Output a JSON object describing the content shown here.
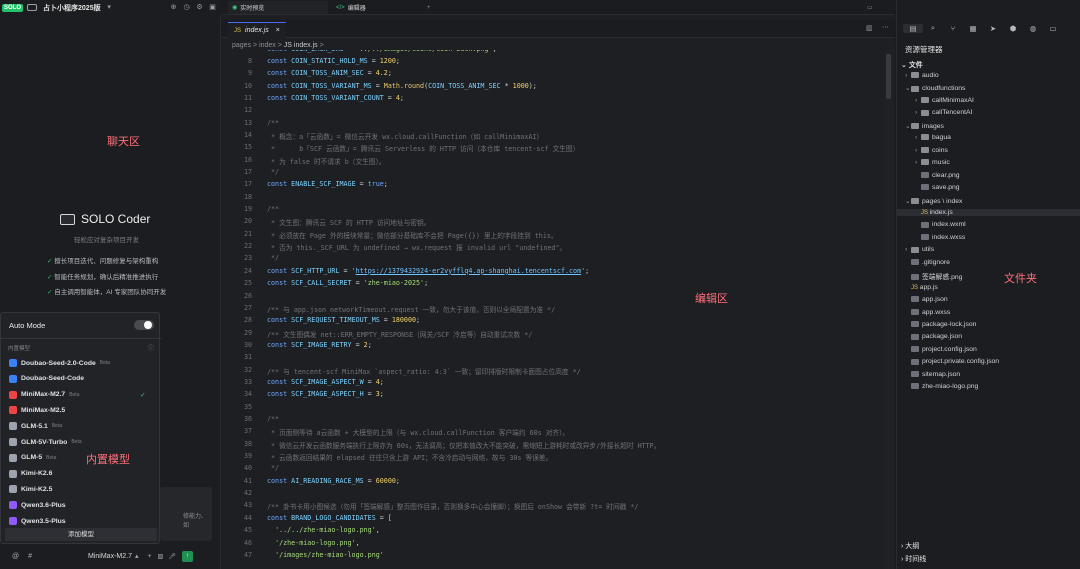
{
  "topbar": {
    "solo": "SOLO",
    "project": "占卜小程序2025版",
    "preview_tab": "实时预览",
    "editor_tab": "编辑器"
  },
  "file_tab": {
    "name": "index.js"
  },
  "breadcrumbs": [
    "pages",
    "index",
    "JS index.js",
    ">"
  ],
  "code_lines": [
    {
      "n": "",
      "t": "const COIN_BACK_SRC = '../../images/coins/coin-back.png';"
    },
    {
      "n": "8",
      "t": "const COIN_STATIC_HOLD_MS = 1200;"
    },
    {
      "n": "9",
      "t": "const COIN_TOSS_ANIM_SEC = 4.2;"
    },
    {
      "n": "10",
      "t": "const COIN_TOSS_VARIANT_MS = Math.round(COIN_TOSS_ANIM_SEC * 1000);"
    },
    {
      "n": "11",
      "t": "const COIN_TOSS_VARIANT_COUNT = 4;"
    },
    {
      "n": "12",
      "t": ""
    },
    {
      "n": "13",
      "t": "/**"
    },
    {
      "n": "14",
      "t": " * 概念：a「云函数」= 微信云开发 wx.cloud.callFunction（如 callMinimaxAI）"
    },
    {
      "n": "15",
      "t": " *      b「SCF 云函数」= 腾讯云 Serverless 的 HTTP 访问（本仓库 tencent-scf 文生图）"
    },
    {
      "n": "16",
      "t": " * 为 false 时不请求 b（文生图）。"
    },
    {
      "n": "17",
      "t": " */"
    },
    {
      "n": "17",
      "t": "const ENABLE_SCF_IMAGE = true;"
    },
    {
      "n": "18",
      "t": ""
    },
    {
      "n": "19",
      "t": "/**"
    },
    {
      "n": "20",
      "t": " * 文生图：腾讯云 SCF 的 HTTP 访问地址与密钥。"
    },
    {
      "n": "21",
      "t": " * 必须放在 Page 外的模块常量；微信部分基础库不会把 Page({}) 里上的字段挂到 this。"
    },
    {
      "n": "22",
      "t": " * 否为 this._SCF_URL 为 undefined → wx.request 报 invalid url \"undefined\"。"
    },
    {
      "n": "23",
      "t": " */"
    },
    {
      "n": "24",
      "t": "const SCF_HTTP_URL = 'https://1379432924-er2vyfflq4.ap-shanghai.tencentscf.com';"
    },
    {
      "n": "25",
      "t": "const SCF_CALL_SECRET = 'zhe-miao-2025';"
    },
    {
      "n": "26",
      "t": ""
    },
    {
      "n": "27",
      "t": "/** 与 app.json networkTimeout.request 一致，勿大于该值，否则以全局配置为准 */"
    },
    {
      "n": "28",
      "t": "const SCF_REQUEST_TIMEOUT_MS = 180000;"
    },
    {
      "n": "29",
      "t": "/** 文生图偶发 net::ERR_EMPTY_RESPONSE（网关/SCF 冷启等）自动重试次数 */"
    },
    {
      "n": "30",
      "t": "const SCF_IMAGE_RETRY = 2;"
    },
    {
      "n": "31",
      "t": ""
    },
    {
      "n": "32",
      "t": "/** 与 tencent-scf MiniMax `aspect_ratio: 4:3` 一致；留印排版时限制卡面图占位高度 */"
    },
    {
      "n": "33",
      "t": "const SCF_IMAGE_ASPECT_W = 4;"
    },
    {
      "n": "34",
      "t": "const SCF_IMAGE_ASPECT_H = 3;"
    },
    {
      "n": "35",
      "t": ""
    },
    {
      "n": "36",
      "t": "/**"
    },
    {
      "n": "37",
      "t": " * 页面侧等待 a云函数 + 大模型的上限（与 wx.cloud.callFunction 客户端约 60s 对齐）。"
    },
    {
      "n": "38",
      "t": " * 微信云开发云函数服务端执行上限亦为 60s，无法调高；仅把本值改大不能突破，需缩短上游耗时或改异步/外接长超时 HTTP。"
    },
    {
      "n": "39",
      "t": " * 云函数返回结果的 elapsed 往往只含上游 API；不含冷启动与网络，故与 30s 等误差。"
    },
    {
      "n": "40",
      "t": " */"
    },
    {
      "n": "41",
      "t": "const AI_READING_RACE_MS = 60000;"
    },
    {
      "n": "42",
      "t": ""
    },
    {
      "n": "43",
      "t": "/** 卦书卡用小图候选（勿用「签端解感」整页图作目录，否则换多中心会撞脚）；换图后 onShow 会带新 ?t= 时间戳 */"
    },
    {
      "n": "44",
      "t": "const BRAND_LOGO_CANDIDATES = ["
    },
    {
      "n": "45",
      "t": "  '../../zhe-miao-logo.png',"
    },
    {
      "n": "46",
      "t": "  '/zhe-miao-logo.png',"
    },
    {
      "n": "47",
      "t": "  '/images/zhe-miao-logo.png'"
    }
  ],
  "zones": {
    "chat": "聊天区",
    "editor": "编辑区",
    "files": "文件夹",
    "models": "内置模型"
  },
  "solo_coder": {
    "title": "SOLO Coder",
    "subtitle": "轻松应对复杂项目开发",
    "features": [
      "擅长项目迭代、问题修复与架构重构",
      "智能任务规划，确认后精准推进执行",
      "自主调用智能体，AI 专家团队协同开发"
    ]
  },
  "model_panel": {
    "auto_mode": "Auto Mode",
    "section": "内置模型",
    "add_label": "添加模型",
    "models": [
      {
        "name": "Doubao-Seed-2.0-Code",
        "beta": "Beta",
        "icon": "doubao-icon",
        "color": "#3b82f6"
      },
      {
        "name": "Doubao-Seed-Code",
        "beta": "",
        "icon": "doubao-icon",
        "color": "#3b82f6"
      },
      {
        "name": "MiniMax-M2.7",
        "beta": "Beta",
        "icon": "minimax-icon",
        "color": "#ef4444",
        "checked": true
      },
      {
        "name": "MiniMax-M2.5",
        "beta": "",
        "icon": "minimax-icon",
        "color": "#ef4444"
      },
      {
        "name": "GLM-5.1",
        "beta": "Beta",
        "icon": "glm-icon",
        "color": "#9ca3af"
      },
      {
        "name": "GLM-5V-Turbo",
        "beta": "Beta",
        "icon": "glm-icon",
        "color": "#9ca3af"
      },
      {
        "name": "GLM-5",
        "beta": "Beta",
        "icon": "glm-icon",
        "color": "#9ca3af"
      },
      {
        "name": "Kimi-K2.6",
        "beta": "",
        "icon": "kimi-icon",
        "color": "#9ca3af"
      },
      {
        "name": "Kimi-K2.5",
        "beta": "",
        "icon": "kimi-icon",
        "color": "#9ca3af"
      },
      {
        "name": "Qwen3.6-Plus",
        "beta": "",
        "icon": "qwen-icon",
        "color": "#8b5cf6"
      },
      {
        "name": "Qwen3.5-Plus",
        "beta": "",
        "icon": "qwen-icon",
        "color": "#8b5cf6"
      }
    ]
  },
  "chat_input": {
    "model": "MiniMax-M2.7",
    "side_text": "修能力、如"
  },
  "explorer": {
    "title": "资源管理器",
    "section": "文件",
    "outline": "大纲",
    "timeline": "时间线"
  },
  "tree": [
    {
      "name": "audio",
      "d": 1,
      "type": "folder"
    },
    {
      "name": "cloudfunctions",
      "d": 1,
      "type": "folder",
      "open": true
    },
    {
      "name": "callMinimaxAI",
      "d": 2,
      "type": "folder"
    },
    {
      "name": "callTencentAI",
      "d": 2,
      "type": "folder"
    },
    {
      "name": "images",
      "d": 1,
      "type": "folder",
      "open": true
    },
    {
      "name": "bagua",
      "d": 2,
      "type": "folder"
    },
    {
      "name": "coins",
      "d": 2,
      "type": "folder"
    },
    {
      "name": "music",
      "d": 2,
      "type": "folder"
    },
    {
      "name": "clear.png",
      "d": 2,
      "type": "file"
    },
    {
      "name": "save.png",
      "d": 2,
      "type": "file"
    },
    {
      "name": "pages \\ index",
      "d": 1,
      "type": "folder",
      "open": true
    },
    {
      "name": "index.js",
      "d": 2,
      "type": "js",
      "sel": true
    },
    {
      "name": "index.wxml",
      "d": 2,
      "type": "file"
    },
    {
      "name": "index.wxss",
      "d": 2,
      "type": "file"
    },
    {
      "name": "utils",
      "d": 1,
      "type": "folder"
    },
    {
      "name": ".gitignore",
      "d": 1,
      "type": "file"
    },
    {
      "name": "签端解惑.png",
      "d": 1,
      "type": "file"
    },
    {
      "name": "app.js",
      "d": 1,
      "type": "js"
    },
    {
      "name": "app.json",
      "d": 1,
      "type": "file"
    },
    {
      "name": "app.wxss",
      "d": 1,
      "type": "file"
    },
    {
      "name": "package-lock.json",
      "d": 1,
      "type": "file"
    },
    {
      "name": "package.json",
      "d": 1,
      "type": "file"
    },
    {
      "name": "project.config.json",
      "d": 1,
      "type": "file"
    },
    {
      "name": "project.private.config.json",
      "d": 1,
      "type": "file"
    },
    {
      "name": "sitemap.json",
      "d": 1,
      "type": "file"
    },
    {
      "name": "zhe-miao-logo.png",
      "d": 1,
      "type": "file"
    }
  ]
}
